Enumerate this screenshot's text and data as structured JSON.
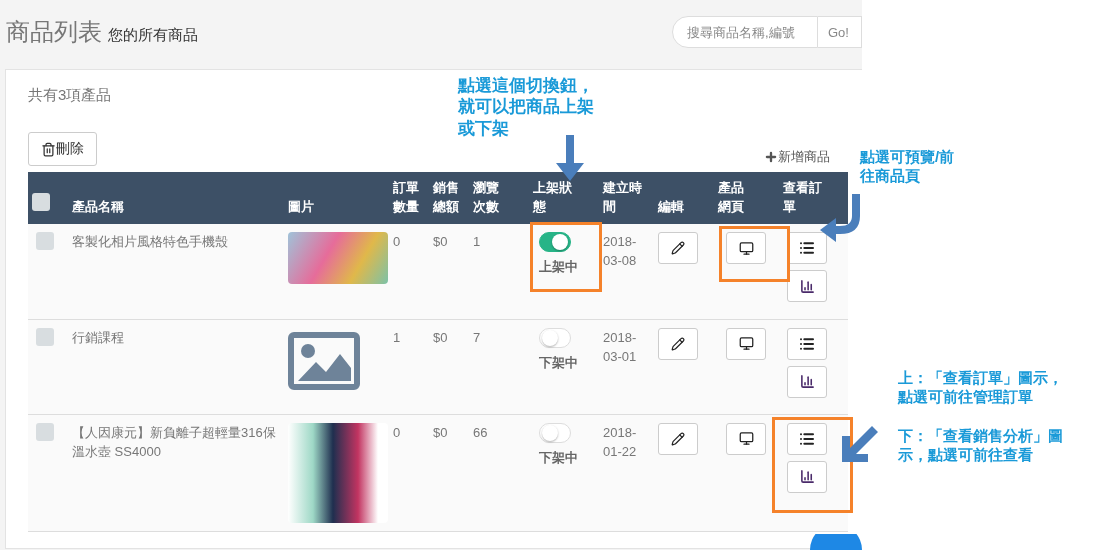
{
  "header": {
    "title": "商品列表",
    "subtitle": "您的所有商品",
    "search": {
      "placeholder": "搜尋商品名稱,編號"
    },
    "go_button": "Go!"
  },
  "panel": {
    "count": "共有3項產品",
    "delete_button": "刪除",
    "add_link": "新增商品"
  },
  "table": {
    "select_all": {
      "checked": false
    },
    "columns": [
      "產品名稱",
      "圖片",
      "訂單數量",
      "銷售總額",
      "瀏覽次數",
      "上架狀態",
      "建立時間",
      "編輯",
      "產品網頁",
      "查看訂單"
    ],
    "rows": [
      {
        "checked": false,
        "name": "客製化相片風格特色手機殼",
        "orders": "0",
        "sales": "$0",
        "views": "1",
        "on": true,
        "status": "上架中",
        "date": "2018-03-08"
      },
      {
        "checked": false,
        "name": "行銷課程",
        "orders": "1",
        "sales": "$0",
        "views": "7",
        "on": false,
        "status": "下架中",
        "date": "2018-03-01"
      },
      {
        "checked": false,
        "name": "【人因康元】新負離子超輕量316保溫水壺 SS4000",
        "orders": "0",
        "sales": "$0",
        "views": "66",
        "on": false,
        "status": "下架中",
        "date": "2018-01-22"
      }
    ]
  },
  "annotations": [
    {
      "kind": "toggle",
      "lines": [
        "點選這個切換鈕，",
        "就可以把商品上架",
        "或下架"
      ]
    },
    {
      "kind": "page",
      "lines": [
        "點選可預覽/前",
        "往商品頁"
      ]
    },
    {
      "kind": "orders",
      "lines": [
        "上：「查看訂單」圖示，",
        "點選可前往管理訂單"
      ]
    },
    {
      "kind": "analysis",
      "lines": [
        "下：「查看銷售分析」圖",
        "示，點選可前往查看"
      ]
    }
  ]
}
